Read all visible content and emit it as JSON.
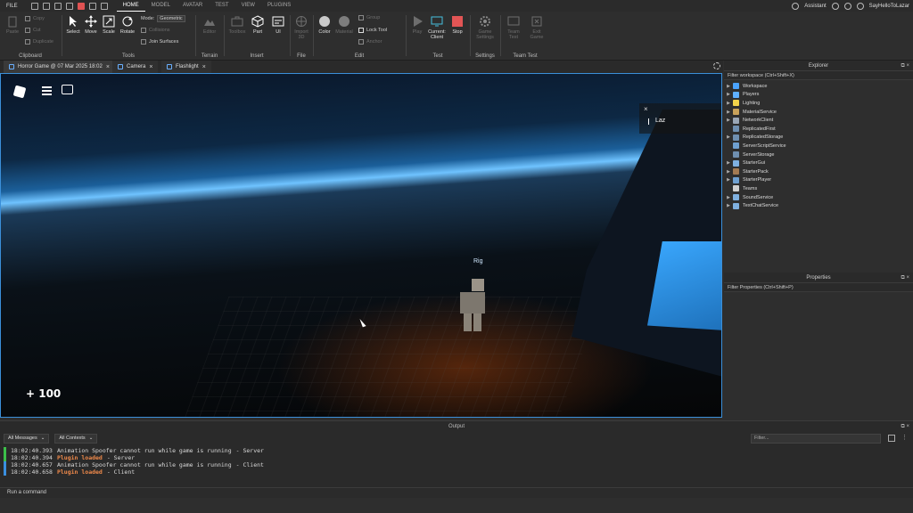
{
  "menubar": {
    "file": "FILE",
    "tabs": [
      "HOME",
      "MODEL",
      "AVATAR",
      "TEST",
      "VIEW",
      "PLUGINS"
    ],
    "assistant": "Assistant",
    "user": "SayHelloToLazar"
  },
  "ribbon": {
    "clipboard": {
      "paste": "Paste",
      "copy": "Copy",
      "cut": "Cut",
      "duplicate": "Duplicate",
      "label": "Clipboard"
    },
    "tools": {
      "select": "Select",
      "move": "Move",
      "scale": "Scale",
      "rotate": "Rotate",
      "mode_label": "Mode:",
      "mode_value": "Geometric",
      "collisions": "Collisions",
      "join_surfaces": "Join Surfaces",
      "label": "Tools"
    },
    "terrain": {
      "editor": "Editor",
      "label": "Terrain"
    },
    "insert": {
      "toolbox": "Toolbox",
      "part": "Part",
      "ui": "UI",
      "label": "Insert"
    },
    "file": {
      "import_3d": "Import 3D",
      "label": "File"
    },
    "edit": {
      "color": "Color",
      "material": "Material",
      "group": "Group",
      "lock_tool": "Lock Tool",
      "anchor": "Anchor",
      "label": "Edit"
    },
    "test": {
      "play": "Play",
      "current_client": "Current: Client",
      "stop": "Stop",
      "label": "Test"
    },
    "settings": {
      "game_settings": "Game Settings",
      "label": "Settings"
    },
    "team_test": {
      "team_test": "Team Test",
      "exit_game": "Exit Game",
      "label": "Team Test"
    }
  },
  "doc_tabs": [
    "Horror Game @ 07 Mar 2025 18:02",
    "Camera",
    "Flashlight"
  ],
  "viewport": {
    "rig_label": "Rig",
    "health": "+ 100",
    "player_name": "Laz"
  },
  "explorer": {
    "title": "Explorer",
    "filter": "Filter workspace (Ctrl+Shift+X)",
    "items": [
      {
        "label": "Workspace",
        "color": "#4aa3ff",
        "expand": true
      },
      {
        "label": "Players",
        "color": "#5fb0ff",
        "expand": true
      },
      {
        "label": "Lighting",
        "color": "#f2d34a",
        "expand": true
      },
      {
        "label": "MaterialService",
        "color": "#c8a15a",
        "expand": true
      },
      {
        "label": "NetworkClient",
        "color": "#9aa6b5",
        "expand": true
      },
      {
        "label": "ReplicatedFirst",
        "color": "#6f8fb0",
        "expand": false
      },
      {
        "label": "ReplicatedStorage",
        "color": "#6f8fb0",
        "expand": true
      },
      {
        "label": "ServerScriptService",
        "color": "#6fa0d0",
        "expand": false
      },
      {
        "label": "ServerStorage",
        "color": "#6f8fb0",
        "expand": false
      },
      {
        "label": "StarterGui",
        "color": "#7fb0e0",
        "expand": true
      },
      {
        "label": "StarterPack",
        "color": "#a37a52",
        "expand": true
      },
      {
        "label": "StarterPlayer",
        "color": "#6fa0d0",
        "expand": true
      },
      {
        "label": "Teams",
        "color": "#d0d0d0",
        "expand": false
      },
      {
        "label": "SoundService",
        "color": "#7fb0e0",
        "expand": true
      },
      {
        "label": "TextChatService",
        "color": "#7fb0e0",
        "expand": true
      }
    ]
  },
  "properties": {
    "title": "Properties",
    "filter": "Filter Properties (Ctrl+Shift+P)"
  },
  "output": {
    "title": "Output",
    "messages_filter": "All Messages",
    "contexts_filter": "All Contexts",
    "filter_placeholder": "Filter...",
    "logs": [
      {
        "ts": "18:02:40.393",
        "msg": "Animation Spoofer cannot run while game is running",
        "ctx": "-  Server",
        "bar": "#3cc04a",
        "plugin": false
      },
      {
        "ts": "18:02:40.394",
        "msg": "Plugin loaded",
        "ctx": "-  Server",
        "bar": "#3cc04a",
        "plugin": true
      },
      {
        "ts": "18:02:40.657",
        "msg": "Animation Spoofer cannot run while game is running",
        "ctx": "-  Client",
        "bar": "#3a8fe0",
        "plugin": false
      },
      {
        "ts": "18:02:40.658",
        "msg": "Plugin loaded",
        "ctx": "-  Client",
        "bar": "#3a8fe0",
        "plugin": true
      }
    ]
  },
  "command_bar": {
    "placeholder": "Run a command"
  }
}
